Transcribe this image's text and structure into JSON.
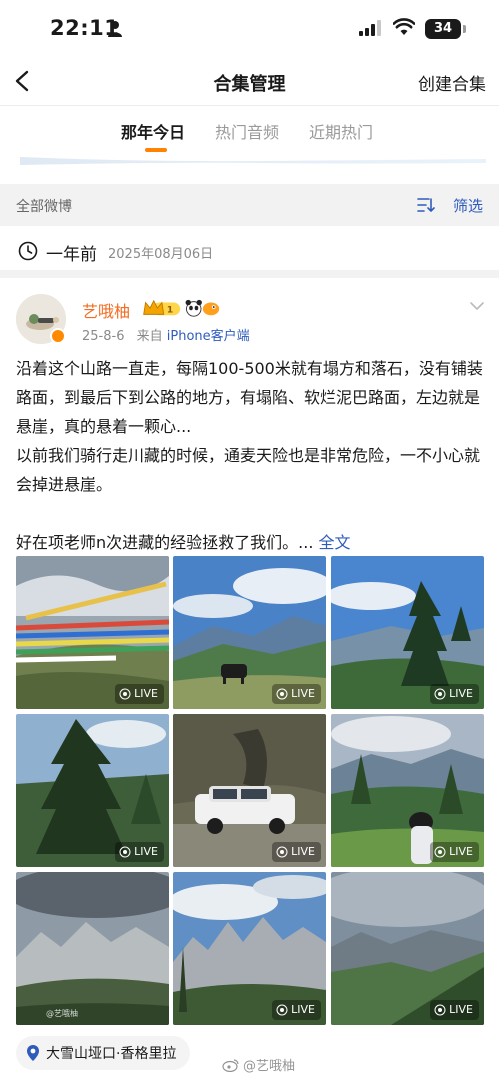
{
  "status_bar": {
    "time": "22:11",
    "battery": "34",
    "person_icon": "person-icon",
    "signal_icon": "cellular-signal-icon",
    "wifi_icon": "wifi-icon"
  },
  "nav": {
    "back_icon": "back-chevron-icon",
    "title": "合集管理",
    "create_label": "创建合集"
  },
  "tabs": [
    {
      "label": "那年今日",
      "active": true
    },
    {
      "label": "热门音频",
      "active": false
    },
    {
      "label": "近期热门",
      "active": false
    }
  ],
  "filter_bar": {
    "all_label": "全部微博",
    "filter_label": "筛选",
    "filter_icon": "filter-sort-icon"
  },
  "time_header": {
    "icon": "clock-icon",
    "ago": "一年前",
    "date": "2025年08月06日"
  },
  "post": {
    "username": "艺哦柚",
    "badge_level": "1",
    "date": "25-8-6",
    "source_prefix": "来自",
    "source": "iPhone客户端",
    "text_lines": [
      "沿着这个山路一直走，每隔100-500米就有塌方和落石，没有铺装路面，到最后下到公路的地方，有塌陷、软烂泥巴路面，左边就是悬崖，真的悬着一颗心...",
      "以前我们骑行走川藏的时候，通麦天险也是非常危险，一不小心就会掉进悬崖。",
      "好在项老师n次进藏的经验拯救了我们。..."
    ],
    "more_label": "全文",
    "live_label": "LIVE",
    "photo_watermark": "@艺哦柚",
    "photos": [
      {
        "name": "prayer-flags-photo",
        "live": true
      },
      {
        "name": "yak-valley-photo",
        "live": true
      },
      {
        "name": "pine-mountain-photo",
        "live": true
      },
      {
        "name": "forest-tree-photo",
        "live": true
      },
      {
        "name": "white-suv-photo",
        "live": true
      },
      {
        "name": "girl-forest-photo",
        "live": true
      },
      {
        "name": "rocky-peaks-photo",
        "live": false
      },
      {
        "name": "jagged-ridge-photo",
        "live": true
      },
      {
        "name": "green-slope-photo",
        "live": true
      }
    ],
    "location": "大雪山垭口·香格里拉",
    "weibo_watermark": "@艺哦柚"
  },
  "colors": {
    "accent_orange": "#ff8200",
    "link_blue": "#2f5bbd",
    "username_orange": "#f36c21"
  }
}
